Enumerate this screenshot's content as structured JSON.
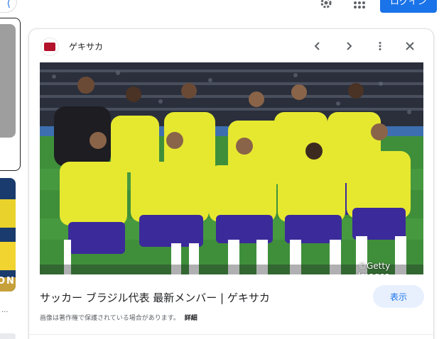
{
  "topbar": {
    "login_label": "ログイン"
  },
  "panel": {
    "site_name": "ゲキサカ",
    "title": "サッカー ブラジル代表 最新メンバー | ゲキサカ",
    "view_label": "表示",
    "copyright_text": "画像は著作権で保護されている場合があります。",
    "details_label": "詳細",
    "watermark": "©Getty Images"
  },
  "left": {
    "thumb_text": "ON",
    "dots": "..."
  },
  "colors": {
    "accent": "#1a73e8",
    "shirt": "#e6e830",
    "shorts": "#3b2a9a",
    "pitch": "#3f8f3a"
  }
}
